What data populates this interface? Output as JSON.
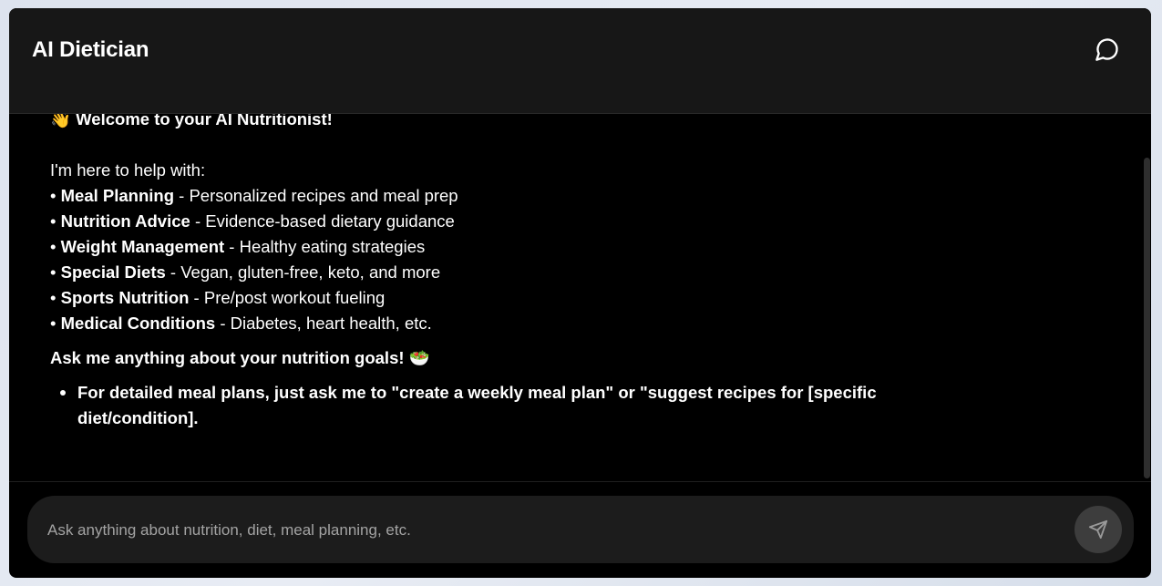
{
  "app": {
    "title": "AI Dietician"
  },
  "icons": {
    "chat": "chat-bubble-icon",
    "send": "send-icon"
  },
  "message": {
    "welcome": "👋 Welcome to your AI Nutritionist!",
    "intro": "I'm here to help with:",
    "items": [
      {
        "label": "Meal Planning",
        "desc": " - Personalized recipes and meal prep"
      },
      {
        "label": "Nutrition Advice",
        "desc": " - Evidence-based dietary guidance"
      },
      {
        "label": "Weight Management",
        "desc": " - Healthy eating strategies"
      },
      {
        "label": "Special Diets",
        "desc": " - Vegan, gluten-free, keto, and more"
      },
      {
        "label": "Sports Nutrition",
        "desc": " - Pre/post workout fueling"
      },
      {
        "label": "Medical Conditions",
        "desc": " - Diabetes, heart health, etc."
      }
    ],
    "cta": "Ask me anything about your nutrition goals! 🥗",
    "tip": "For detailed meal plans, just ask me to \"create a weekly meal plan\" or \"suggest recipes for [specific diet/condition]."
  },
  "composer": {
    "placeholder": "Ask anything about nutrition, diet, meal planning, etc."
  },
  "colors": {
    "header_bg": "#171717",
    "body_bg": "#000000",
    "composer_bg": "#1c1c1c",
    "send_bg": "#3d3d3d"
  }
}
